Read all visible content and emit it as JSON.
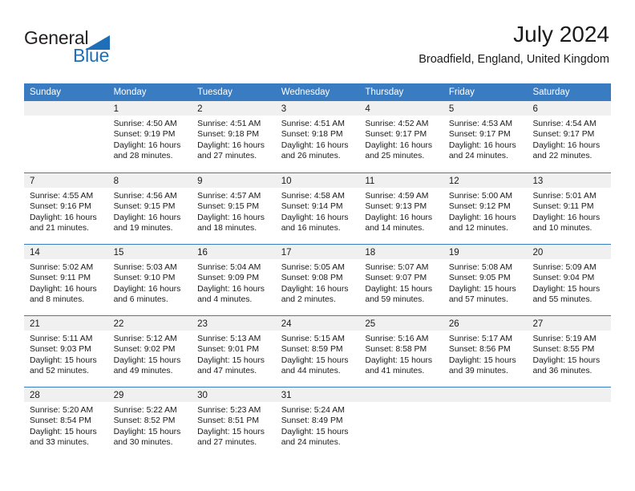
{
  "brand": {
    "word_one": "General",
    "word_two": "Blue",
    "icon": "triangle-logo"
  },
  "header": {
    "title": "July 2024",
    "subtitle": "Broadfield, England, United Kingdom"
  },
  "colors": {
    "header_blue": "#3a7cc2",
    "brand_blue": "#1f6fb8",
    "day_number_bg": "#f0f0f0",
    "text": "#1a1a1a"
  },
  "weekdays": [
    "Sunday",
    "Monday",
    "Tuesday",
    "Wednesday",
    "Thursday",
    "Friday",
    "Saturday"
  ],
  "weeks": [
    [
      {
        "day": "",
        "sunrise": "",
        "sunset": "",
        "daylight_line1": "",
        "daylight_line2": ""
      },
      {
        "day": "1",
        "sunrise": "Sunrise: 4:50 AM",
        "sunset": "Sunset: 9:19 PM",
        "daylight_line1": "Daylight: 16 hours",
        "daylight_line2": "and 28 minutes."
      },
      {
        "day": "2",
        "sunrise": "Sunrise: 4:51 AM",
        "sunset": "Sunset: 9:18 PM",
        "daylight_line1": "Daylight: 16 hours",
        "daylight_line2": "and 27 minutes."
      },
      {
        "day": "3",
        "sunrise": "Sunrise: 4:51 AM",
        "sunset": "Sunset: 9:18 PM",
        "daylight_line1": "Daylight: 16 hours",
        "daylight_line2": "and 26 minutes."
      },
      {
        "day": "4",
        "sunrise": "Sunrise: 4:52 AM",
        "sunset": "Sunset: 9:17 PM",
        "daylight_line1": "Daylight: 16 hours",
        "daylight_line2": "and 25 minutes."
      },
      {
        "day": "5",
        "sunrise": "Sunrise: 4:53 AM",
        "sunset": "Sunset: 9:17 PM",
        "daylight_line1": "Daylight: 16 hours",
        "daylight_line2": "and 24 minutes."
      },
      {
        "day": "6",
        "sunrise": "Sunrise: 4:54 AM",
        "sunset": "Sunset: 9:17 PM",
        "daylight_line1": "Daylight: 16 hours",
        "daylight_line2": "and 22 minutes."
      }
    ],
    [
      {
        "day": "7",
        "sunrise": "Sunrise: 4:55 AM",
        "sunset": "Sunset: 9:16 PM",
        "daylight_line1": "Daylight: 16 hours",
        "daylight_line2": "and 21 minutes."
      },
      {
        "day": "8",
        "sunrise": "Sunrise: 4:56 AM",
        "sunset": "Sunset: 9:15 PM",
        "daylight_line1": "Daylight: 16 hours",
        "daylight_line2": "and 19 minutes."
      },
      {
        "day": "9",
        "sunrise": "Sunrise: 4:57 AM",
        "sunset": "Sunset: 9:15 PM",
        "daylight_line1": "Daylight: 16 hours",
        "daylight_line2": "and 18 minutes."
      },
      {
        "day": "10",
        "sunrise": "Sunrise: 4:58 AM",
        "sunset": "Sunset: 9:14 PM",
        "daylight_line1": "Daylight: 16 hours",
        "daylight_line2": "and 16 minutes."
      },
      {
        "day": "11",
        "sunrise": "Sunrise: 4:59 AM",
        "sunset": "Sunset: 9:13 PM",
        "daylight_line1": "Daylight: 16 hours",
        "daylight_line2": "and 14 minutes."
      },
      {
        "day": "12",
        "sunrise": "Sunrise: 5:00 AM",
        "sunset": "Sunset: 9:12 PM",
        "daylight_line1": "Daylight: 16 hours",
        "daylight_line2": "and 12 minutes."
      },
      {
        "day": "13",
        "sunrise": "Sunrise: 5:01 AM",
        "sunset": "Sunset: 9:11 PM",
        "daylight_line1": "Daylight: 16 hours",
        "daylight_line2": "and 10 minutes."
      }
    ],
    [
      {
        "day": "14",
        "sunrise": "Sunrise: 5:02 AM",
        "sunset": "Sunset: 9:11 PM",
        "daylight_line1": "Daylight: 16 hours",
        "daylight_line2": "and 8 minutes."
      },
      {
        "day": "15",
        "sunrise": "Sunrise: 5:03 AM",
        "sunset": "Sunset: 9:10 PM",
        "daylight_line1": "Daylight: 16 hours",
        "daylight_line2": "and 6 minutes."
      },
      {
        "day": "16",
        "sunrise": "Sunrise: 5:04 AM",
        "sunset": "Sunset: 9:09 PM",
        "daylight_line1": "Daylight: 16 hours",
        "daylight_line2": "and 4 minutes."
      },
      {
        "day": "17",
        "sunrise": "Sunrise: 5:05 AM",
        "sunset": "Sunset: 9:08 PM",
        "daylight_line1": "Daylight: 16 hours",
        "daylight_line2": "and 2 minutes."
      },
      {
        "day": "18",
        "sunrise": "Sunrise: 5:07 AM",
        "sunset": "Sunset: 9:07 PM",
        "daylight_line1": "Daylight: 15 hours",
        "daylight_line2": "and 59 minutes."
      },
      {
        "day": "19",
        "sunrise": "Sunrise: 5:08 AM",
        "sunset": "Sunset: 9:05 PM",
        "daylight_line1": "Daylight: 15 hours",
        "daylight_line2": "and 57 minutes."
      },
      {
        "day": "20",
        "sunrise": "Sunrise: 5:09 AM",
        "sunset": "Sunset: 9:04 PM",
        "daylight_line1": "Daylight: 15 hours",
        "daylight_line2": "and 55 minutes."
      }
    ],
    [
      {
        "day": "21",
        "sunrise": "Sunrise: 5:11 AM",
        "sunset": "Sunset: 9:03 PM",
        "daylight_line1": "Daylight: 15 hours",
        "daylight_line2": "and 52 minutes."
      },
      {
        "day": "22",
        "sunrise": "Sunrise: 5:12 AM",
        "sunset": "Sunset: 9:02 PM",
        "daylight_line1": "Daylight: 15 hours",
        "daylight_line2": "and 49 minutes."
      },
      {
        "day": "23",
        "sunrise": "Sunrise: 5:13 AM",
        "sunset": "Sunset: 9:01 PM",
        "daylight_line1": "Daylight: 15 hours",
        "daylight_line2": "and 47 minutes."
      },
      {
        "day": "24",
        "sunrise": "Sunrise: 5:15 AM",
        "sunset": "Sunset: 8:59 PM",
        "daylight_line1": "Daylight: 15 hours",
        "daylight_line2": "and 44 minutes."
      },
      {
        "day": "25",
        "sunrise": "Sunrise: 5:16 AM",
        "sunset": "Sunset: 8:58 PM",
        "daylight_line1": "Daylight: 15 hours",
        "daylight_line2": "and 41 minutes."
      },
      {
        "day": "26",
        "sunrise": "Sunrise: 5:17 AM",
        "sunset": "Sunset: 8:56 PM",
        "daylight_line1": "Daylight: 15 hours",
        "daylight_line2": "and 39 minutes."
      },
      {
        "day": "27",
        "sunrise": "Sunrise: 5:19 AM",
        "sunset": "Sunset: 8:55 PM",
        "daylight_line1": "Daylight: 15 hours",
        "daylight_line2": "and 36 minutes."
      }
    ],
    [
      {
        "day": "28",
        "sunrise": "Sunrise: 5:20 AM",
        "sunset": "Sunset: 8:54 PM",
        "daylight_line1": "Daylight: 15 hours",
        "daylight_line2": "and 33 minutes."
      },
      {
        "day": "29",
        "sunrise": "Sunrise: 5:22 AM",
        "sunset": "Sunset: 8:52 PM",
        "daylight_line1": "Daylight: 15 hours",
        "daylight_line2": "and 30 minutes."
      },
      {
        "day": "30",
        "sunrise": "Sunrise: 5:23 AM",
        "sunset": "Sunset: 8:51 PM",
        "daylight_line1": "Daylight: 15 hours",
        "daylight_line2": "and 27 minutes."
      },
      {
        "day": "31",
        "sunrise": "Sunrise: 5:24 AM",
        "sunset": "Sunset: 8:49 PM",
        "daylight_line1": "Daylight: 15 hours",
        "daylight_line2": "and 24 minutes."
      },
      {
        "day": "",
        "sunrise": "",
        "sunset": "",
        "daylight_line1": "",
        "daylight_line2": ""
      },
      {
        "day": "",
        "sunrise": "",
        "sunset": "",
        "daylight_line1": "",
        "daylight_line2": ""
      },
      {
        "day": "",
        "sunrise": "",
        "sunset": "",
        "daylight_line1": "",
        "daylight_line2": ""
      }
    ]
  ]
}
